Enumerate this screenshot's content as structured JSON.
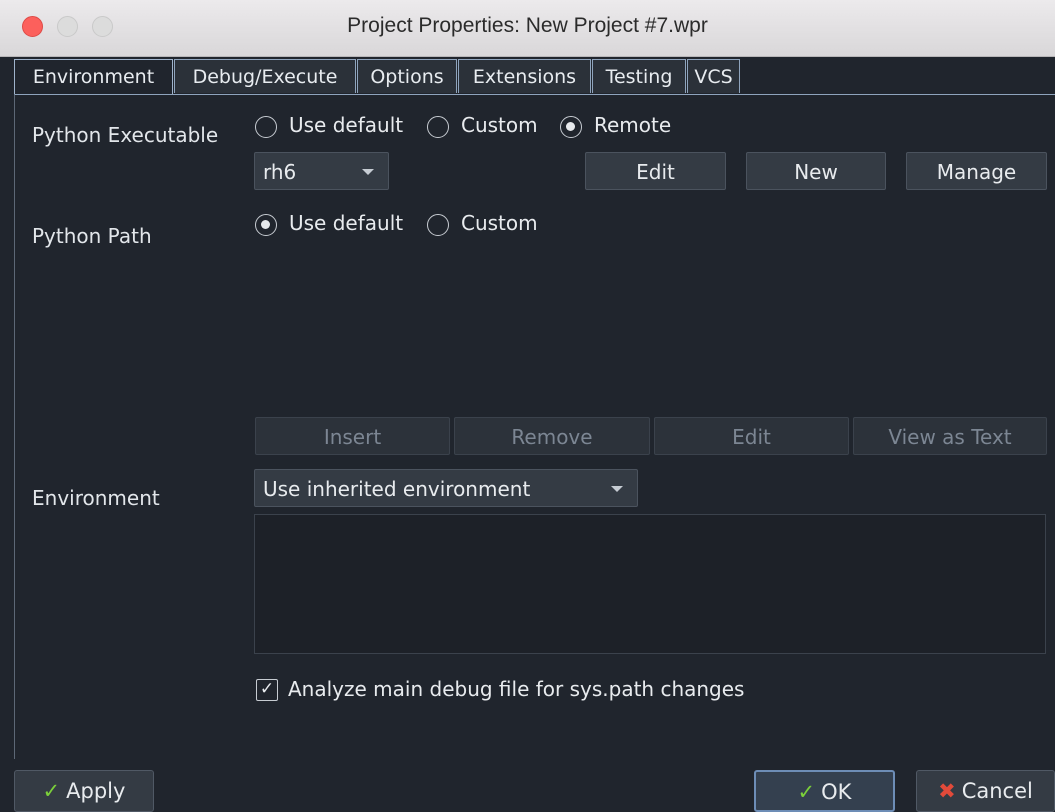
{
  "window": {
    "title": "Project Properties: New Project #7.wpr"
  },
  "tabs": [
    "Environment",
    "Debug/Execute",
    "Options",
    "Extensions",
    "Testing",
    "VCS"
  ],
  "python_executable": {
    "label": "Python Executable",
    "options": [
      "Use default",
      "Custom",
      "Remote"
    ],
    "selected": "Remote",
    "remote_host": "rh6",
    "buttons": [
      "Edit",
      "New",
      "Manage"
    ]
  },
  "python_path": {
    "label": "Python Path",
    "options": [
      "Use default",
      "Custom"
    ],
    "selected": "Use default",
    "buttons": [
      "Insert",
      "Remove",
      "Edit",
      "View as Text"
    ]
  },
  "environment": {
    "label": "Environment",
    "mode": "Use inherited environment"
  },
  "analyze_checkbox": {
    "label": "Analyze main debug file for sys.path changes",
    "checked": true
  },
  "footer": {
    "apply": "Apply",
    "ok": "OK",
    "cancel": "Cancel"
  },
  "colors": {
    "background": "#20252d",
    "accent_green": "#7bd03a",
    "accent_red": "#e24a3a",
    "tab_border": "#8fa4bd"
  }
}
